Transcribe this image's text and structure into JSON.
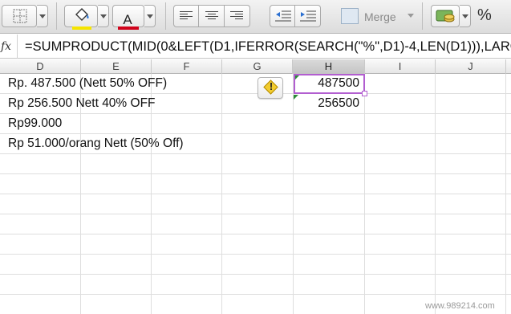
{
  "toolbar": {
    "font_color_glyph": "A",
    "merge_label": "Merge",
    "percent_label": "%",
    "fill_color": "#f5e400",
    "font_color": "#d0021b",
    "icons": [
      "borders-icon",
      "fill-color-icon",
      "font-color-icon",
      "align-left-icon",
      "align-center-icon",
      "align-right-icon",
      "decrease-indent-icon",
      "increase-indent-icon",
      "merge-icon",
      "currency-icon",
      "percent-icon"
    ]
  },
  "formula_bar": {
    "fx_label": "fx",
    "formula": "=SUMPRODUCT(MID(0&LEFT(D1,IFERROR(SEARCH(\"%\",D1)-4,LEN(D1))),LARG"
  },
  "columns": [
    "D",
    "E",
    "F",
    "G",
    "H",
    "I",
    "J"
  ],
  "active_column": "H",
  "cells": {
    "D1": "Rp. 487.500 (Nett 50% OFF)",
    "D2": "Rp 256.500 Nett 40% OFF",
    "D3": "Rp99.000",
    "D4": "Rp 51.000/orang Nett (50% Off)",
    "H1": "487500",
    "H2": "256500"
  },
  "warning_glyph": "!",
  "watermark": "www.989214.com",
  "colors": {
    "selection": "#b25ed0",
    "error_indicator": "#2e8b3a",
    "warning": "#f2cc2e"
  }
}
